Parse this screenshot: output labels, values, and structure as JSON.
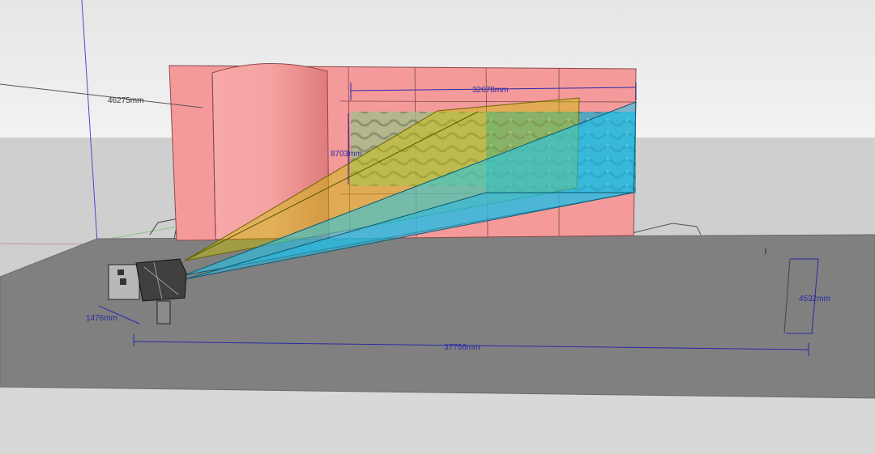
{
  "dimensions": {
    "building_distance": "46275mm",
    "projection_width": "32678mm",
    "projection_height": "8703mm",
    "projector_offset": "1476mm",
    "ground_span": "37756mm",
    "projector_height": "4532mm"
  },
  "colors": {
    "sky_top": "#e9e9e9",
    "ground_plane": "#c9c9c9",
    "platform": "#7f7f7f",
    "building_facade": "#f59a9a",
    "building_tower": "#f28c8c",
    "yellow_beam": "#c8c000",
    "cyan_beam": "#1ec8f0",
    "dimension_line": "#2a2aa6"
  },
  "icons": {
    "projector": "projector-cabinet-icon"
  }
}
